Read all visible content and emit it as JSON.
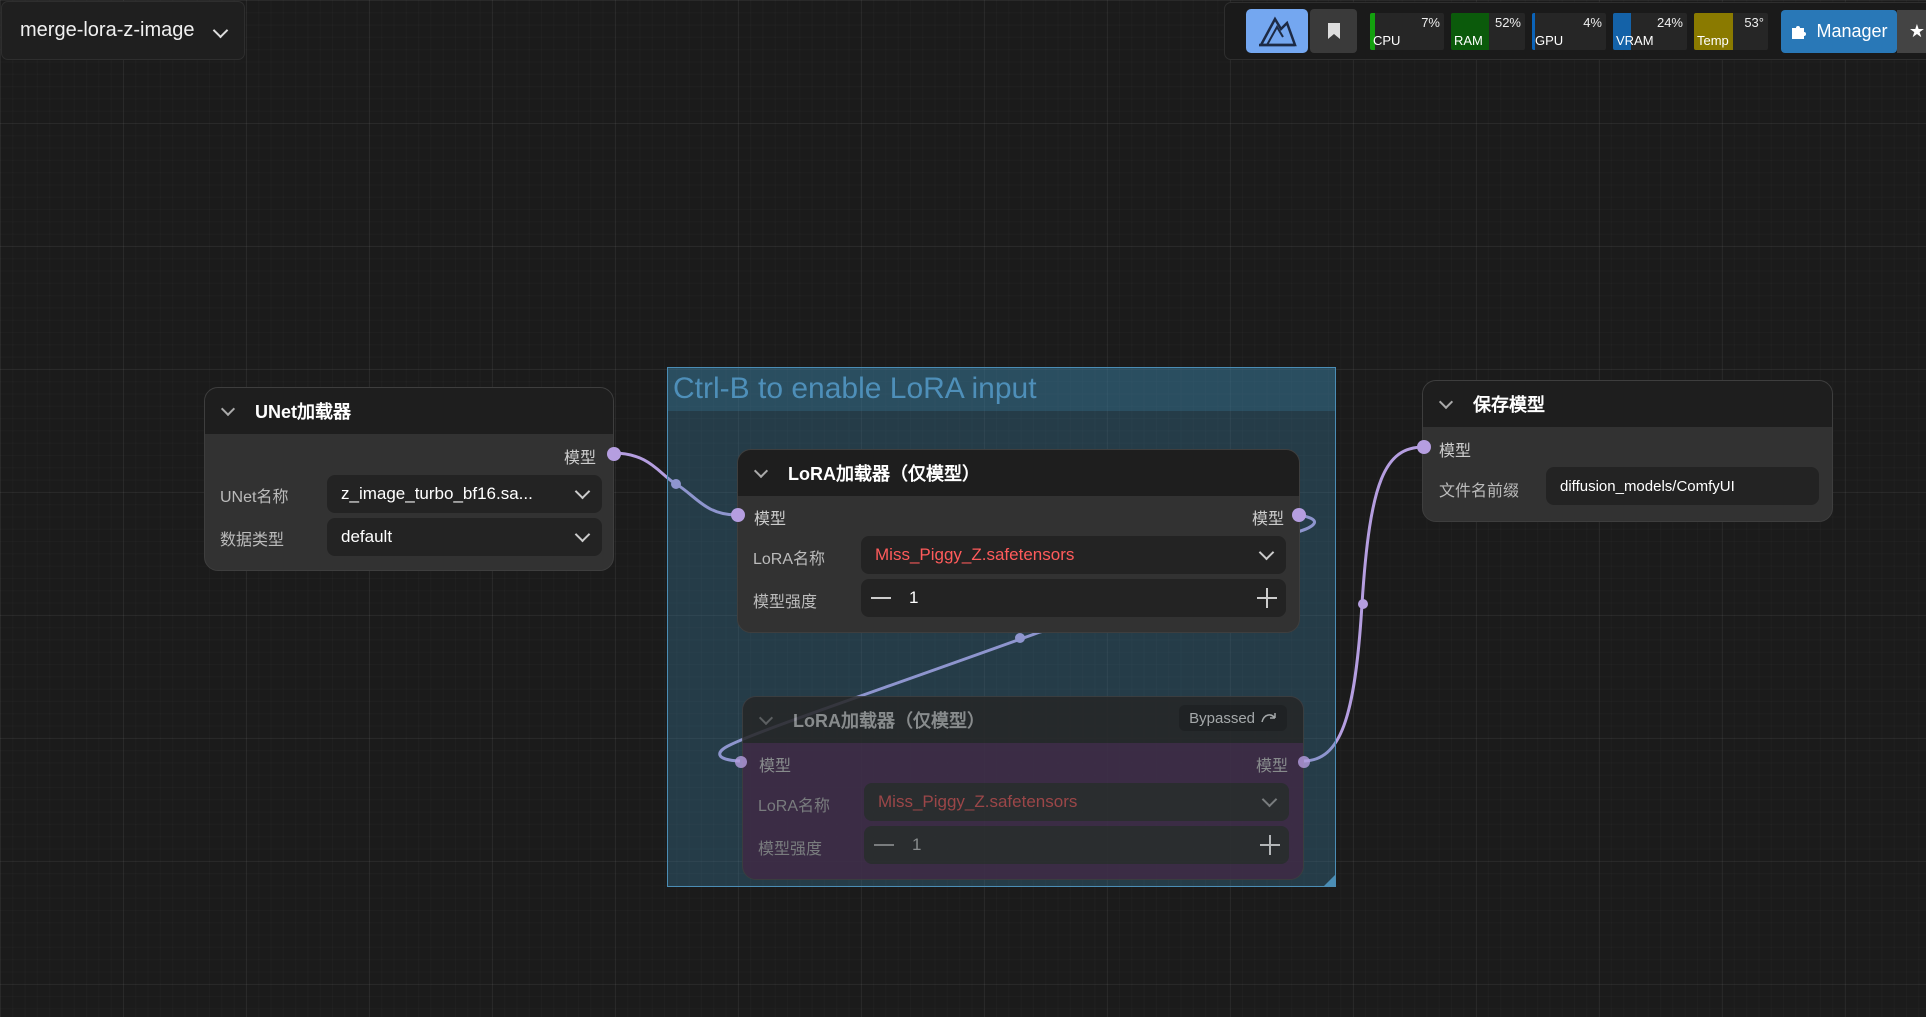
{
  "workflow": {
    "name": "merge-lora-z-image"
  },
  "toolbar": {
    "monitors": [
      {
        "label": "CPU",
        "value": "7%",
        "percent": 7,
        "color": "#13a10e"
      },
      {
        "label": "RAM",
        "value": "52%",
        "percent": 52,
        "color": "#0b5a0b"
      },
      {
        "label": "GPU",
        "value": "4%",
        "percent": 4,
        "color": "#0b63b8"
      },
      {
        "label": "VRAM",
        "value": "24%",
        "percent": 24,
        "color": "#1462a8"
      },
      {
        "label": "Temp",
        "value": "53°",
        "percent": 53,
        "color": "#8a7a00"
      }
    ],
    "manager_label": "Manager"
  },
  "group": {
    "title": "Ctrl-B to enable LoRA input"
  },
  "unet_node": {
    "title": "UNet加载器",
    "output_label": "模型",
    "widgets": [
      {
        "label": "UNet名称",
        "value": "z_image_turbo_bf16.sa..."
      },
      {
        "label": "数据类型",
        "value": "default"
      }
    ]
  },
  "lora_node_1": {
    "title": "LoRA加载器（仅模型）",
    "input_label": "模型",
    "output_label": "模型",
    "lora_name_label": "LoRA名称",
    "lora_name_value": "Miss_Piggy_Z.safetensors",
    "strength_label": "模型强度",
    "strength_value": "1"
  },
  "lora_node_2": {
    "title": "LoRA加载器（仅模型）",
    "badge": "Bypassed",
    "input_label": "模型",
    "output_label": "模型",
    "lora_name_label": "LoRA名称",
    "lora_name_value": "Miss_Piggy_Z.safetensors",
    "strength_label": "模型强度",
    "strength_value": "1"
  },
  "save_node": {
    "title": "保存模型",
    "input_label": "模型",
    "prefix_label": "文件名前缀",
    "prefix_value": "diffusion_models/ComfyUI"
  },
  "colors": {
    "link": "#b59ee0",
    "group": "#3a82a8",
    "bypass": "#3f2a45"
  }
}
